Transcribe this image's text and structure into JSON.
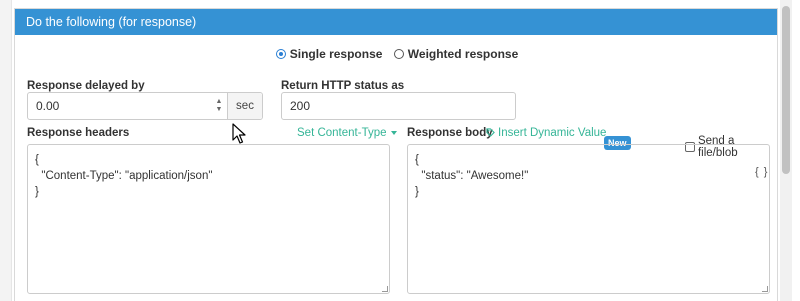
{
  "section_header": "Do the following (for response)",
  "response_mode": {
    "options": [
      {
        "label": "Single response",
        "selected": true
      },
      {
        "label": "Weighted response",
        "selected": false
      }
    ]
  },
  "delay": {
    "label": "Response delayed by",
    "value": "0.00",
    "unit": "sec"
  },
  "status": {
    "label": "Return HTTP status as",
    "value": "200"
  },
  "headers": {
    "label": "Response headers",
    "content_type_link": "Set Content-Type",
    "lines": [
      "{",
      "  \"Content-Type\": \"application/json\"",
      "}"
    ]
  },
  "body": {
    "label": "Response body",
    "insert_link": "Insert Dynamic Value",
    "new_badge": "New",
    "send_file_label": "Send a file/blob",
    "send_file_checked": false,
    "format_icon": "{ }",
    "lines": [
      "{",
      "  \"status\": \"Awesome!\"",
      "}"
    ]
  },
  "colors": {
    "header_bg": "#3592d4",
    "link": "#35b597",
    "badge": "#3592d4"
  }
}
